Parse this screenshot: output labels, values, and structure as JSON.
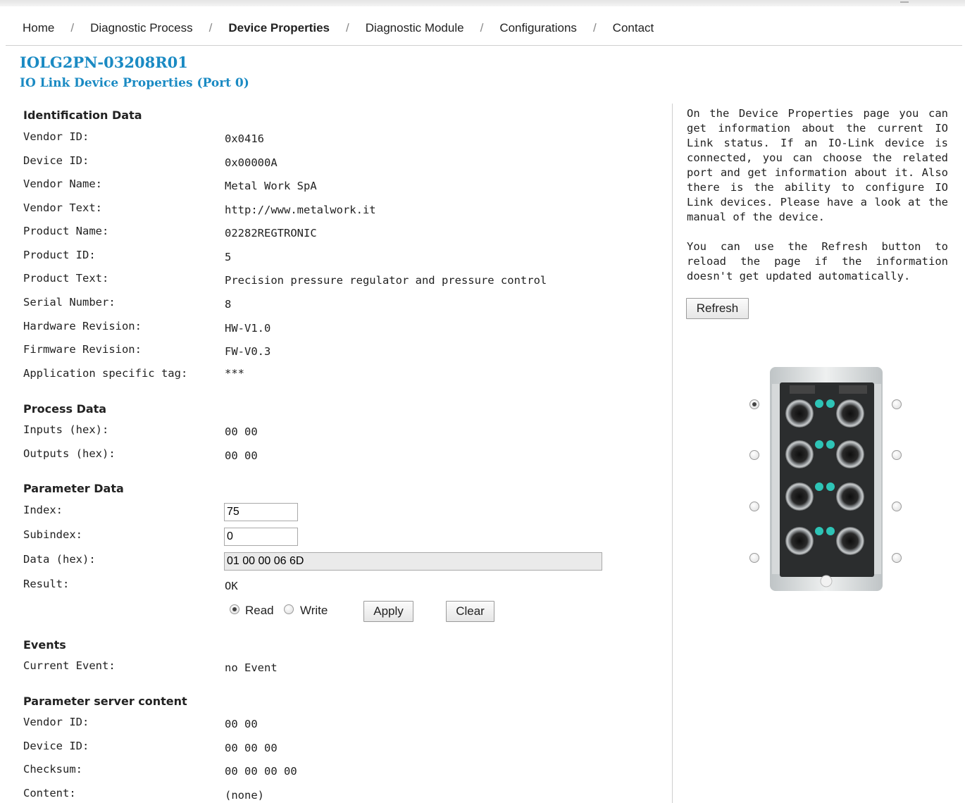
{
  "nav": {
    "items": [
      {
        "label": "Home",
        "active": false
      },
      {
        "label": "Diagnostic Process",
        "active": false
      },
      {
        "label": "Device Properties",
        "active": true
      },
      {
        "label": "Diagnostic Module",
        "active": false
      },
      {
        "label": "Configurations",
        "active": false
      },
      {
        "label": "Contact",
        "active": false
      }
    ],
    "separator": "/"
  },
  "header": {
    "title": "IOLG2PN-03208R01",
    "subtitle": "IO Link Device Properties (Port 0)"
  },
  "identification": {
    "heading": "Identification Data",
    "rows": [
      {
        "label": "Vendor ID:",
        "value": "0x0416"
      },
      {
        "label": "Device ID:",
        "value": "0x00000A"
      },
      {
        "label": "Vendor Name:",
        "value": "Metal Work SpA"
      },
      {
        "label": "Vendor Text:",
        "value": "http://www.metalwork.it"
      },
      {
        "label": "Product Name:",
        "value": "02282REGTRONIC"
      },
      {
        "label": "Product ID:",
        "value": "5"
      },
      {
        "label": "Product Text:",
        "value": "Precision pressure regulator and pressure control"
      },
      {
        "label": "Serial Number:",
        "value": "8"
      },
      {
        "label": "Hardware Revision:",
        "value": "HW-V1.0"
      },
      {
        "label": "Firmware Revision:",
        "value": "FW-V0.3"
      },
      {
        "label": "Application specific tag:",
        "value": "***"
      }
    ]
  },
  "process": {
    "heading": "Process Data",
    "inputs_label": "Inputs (hex):",
    "inputs_value": "00 00",
    "outputs_label": "Outputs (hex):",
    "outputs_value": "00 00"
  },
  "parameter": {
    "heading": "Parameter Data",
    "index_label": "Index:",
    "index_value": "75",
    "subindex_label": "Subindex:",
    "subindex_value": "0",
    "data_label": "Data (hex):",
    "data_value": "01 00 00 06 6D",
    "result_label": "Result:",
    "result_value": "OK",
    "read_label": "Read",
    "write_label": "Write",
    "mode_selected": "read",
    "apply_label": "Apply",
    "clear_label": "Clear"
  },
  "events": {
    "heading": "Events",
    "current_label": "Current Event:",
    "current_value": "no Event"
  },
  "param_server": {
    "heading": "Parameter server content",
    "rows": [
      {
        "label": "Vendor ID:",
        "value": "00 00"
      },
      {
        "label": "Device ID:",
        "value": "00 00 00"
      },
      {
        "label": "Checksum:",
        "value": "00 00 00 00"
      },
      {
        "label": "Content:",
        "value": "(none)"
      }
    ]
  },
  "help": {
    "paragraph1": "On the Device Properties page you can get information about the current IO Link status. If an IO-Link device is connected, you can choose the related port and get information about it. Also there is the ability to configure IO Link devices. Please have a look at the manual of the device.",
    "paragraph2": "You can use the Refresh button to reload the page if the information doesn't get updated automatically.",
    "refresh_label": "Refresh"
  },
  "ports": {
    "selected_port": 0,
    "count": 8
  },
  "colors": {
    "title": "#1a8ac3",
    "led_teal": "#2ec4b6"
  }
}
